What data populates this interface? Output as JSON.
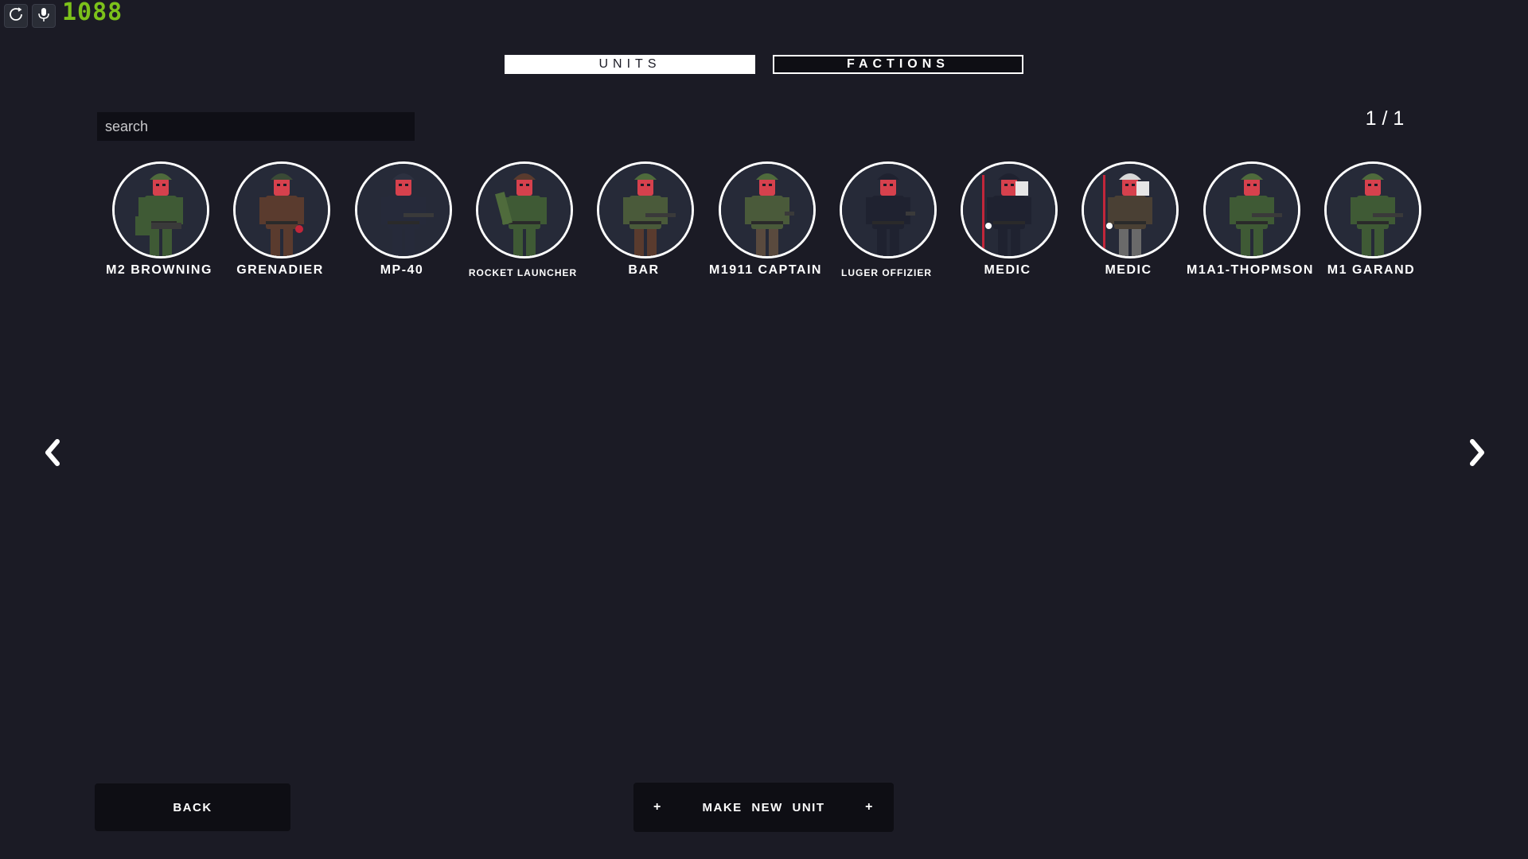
{
  "top_bar": {
    "refresh_icon": "refresh-icon",
    "mic_icon": "microphone-icon",
    "counter": "1088",
    "counter_color": "#7cc11a"
  },
  "tabs": [
    {
      "label": "UNITS",
      "active": true
    },
    {
      "label": "FACTIONS",
      "active": false
    }
  ],
  "search": {
    "placeholder": "search",
    "value": ""
  },
  "pagination": {
    "text": "1 / 1"
  },
  "units": [
    {
      "name": "M2 BROWNING",
      "helmet": "#4f6b3c",
      "uniform": "#3f5a35",
      "pants": "#3f5a35",
      "weapon": "heavy-mg"
    },
    {
      "name": "GRENADIER",
      "helmet": "#3a4a36",
      "uniform": "#5a3b2e",
      "pants": "#5a3b2e",
      "weapon": "grenade"
    },
    {
      "name": "MP-40",
      "helmet": "#2d3140",
      "uniform": "#262a3a",
      "pants": "#262a3a",
      "weapon": "smg"
    },
    {
      "name": "ROCKET LAUNCHER",
      "helmet": "#5a3b2e",
      "uniform": "#3f5a35",
      "pants": "#3f5a35",
      "weapon": "rocket"
    },
    {
      "name": "BAR",
      "helmet": "#4f6b3c",
      "uniform": "#4a5a3a",
      "pants": "#5a3b2e",
      "weapon": "rifle"
    },
    {
      "name": "M1911 CAPTAIN",
      "helmet": "#4f6b3c",
      "uniform": "#4a5a3a",
      "pants": "#5a4a3e",
      "weapon": "pistol"
    },
    {
      "name": "LUGER OFFIZIER",
      "helmet": "#1f2230",
      "uniform": "#1f2230",
      "pants": "#1f2230",
      "weapon": "pistol"
    },
    {
      "name": "MEDIC",
      "helmet": "#1f2230",
      "uniform": "#1f2230",
      "pants": "#1f2230",
      "weapon": "medic"
    },
    {
      "name": "MEDIC",
      "helmet": "#d8d8d8",
      "uniform": "#4a4034",
      "pants": "#6a6a6a",
      "weapon": "medic"
    },
    {
      "name": "M1A1-THOPMSON",
      "helmet": "#4f6b3c",
      "uniform": "#3f5a35",
      "pants": "#3f5a35",
      "weapon": "smg"
    },
    {
      "name": "M1 GARAND",
      "helmet": "#4f6b3c",
      "uniform": "#3f5a35",
      "pants": "#3f5a35",
      "weapon": "rifle"
    }
  ],
  "nav": {
    "prev_icon": "chevron-left-icon",
    "next_icon": "chevron-right-icon"
  },
  "buttons": {
    "back_label": "BACK",
    "make_plus": "+",
    "make_label": "MAKE NEW UNIT"
  }
}
